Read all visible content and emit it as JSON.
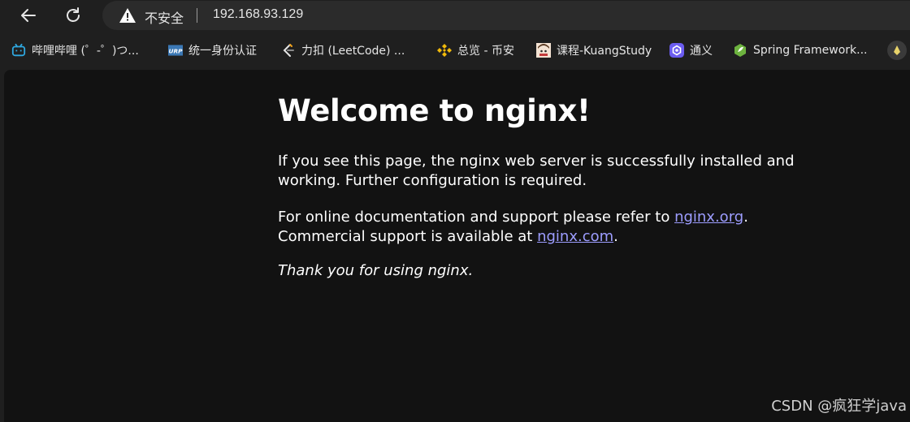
{
  "toolbar": {
    "security_label": "不安全",
    "url": "192.168.93.129"
  },
  "bookmarks": [
    {
      "label": "哔哩哔哩 (゜-゜)つ...",
      "icon": "bilibili-icon"
    },
    {
      "label": "统一身份认证",
      "icon": "urp-icon"
    },
    {
      "label": "力扣 (LeetCode) ...",
      "icon": "leetcode-icon"
    },
    {
      "label": "总览 - 币安",
      "icon": "binance-icon"
    },
    {
      "label": "课程-KuangStudy",
      "icon": "avatar-icon"
    },
    {
      "label": "通义",
      "icon": "tongyi-icon"
    },
    {
      "label": "Spring Framework...",
      "icon": "spring-icon"
    }
  ],
  "page": {
    "heading": "Welcome to nginx!",
    "p1_line1": "If you see this page, the nginx web server is successfully installed and",
    "p1_line2": "working. Further configuration is required.",
    "p2_line1_prefix": "For online documentation and support please refer to ",
    "p2_link1": "nginx.org",
    "p2_line1_suffix": ".",
    "p2_line2_prefix": "Commercial support is available at ",
    "p2_link2": "nginx.com",
    "p2_line2_suffix": ".",
    "p3": "Thank you for using nginx."
  },
  "watermark": "CSDN @疯狂学java",
  "colors": {
    "link": "#9d9dff",
    "content_bg": "#121212",
    "chrome_bg": "#1f1f1f"
  }
}
